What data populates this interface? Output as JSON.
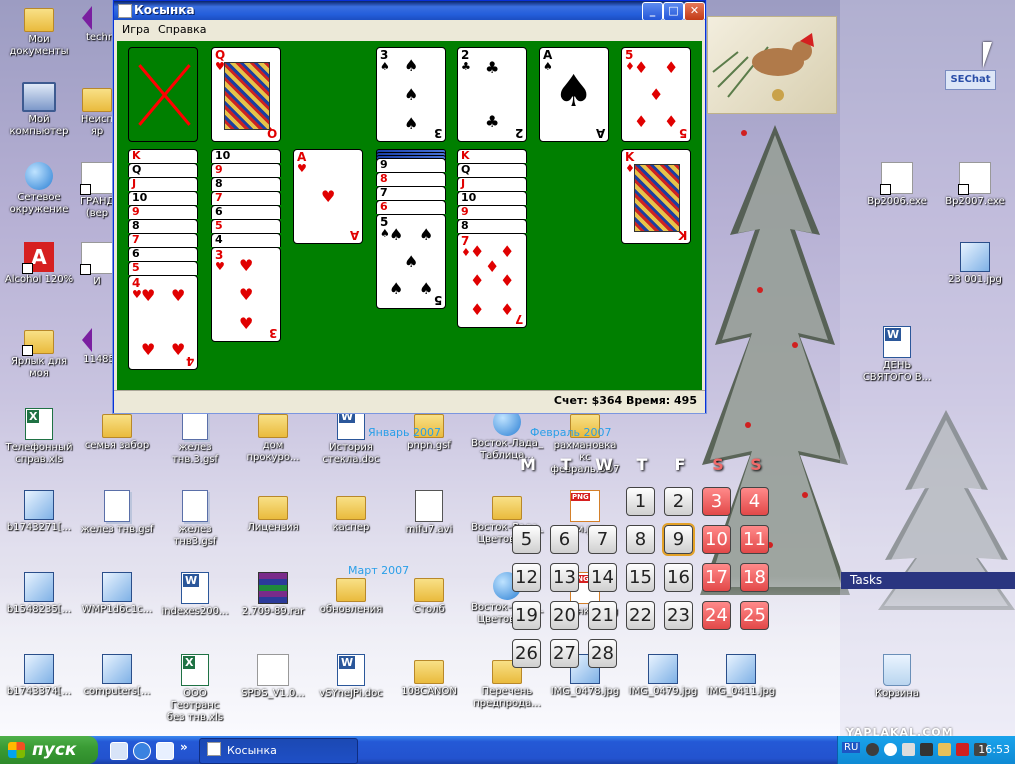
{
  "window": {
    "title": "Косынка",
    "menu": [
      "Игра",
      "Справка"
    ],
    "status": "Счет: $364 Время: 495"
  },
  "game": {
    "foundations": [
      {
        "rank": "3",
        "suit": "♠"
      },
      {
        "rank": "2",
        "suit": "♣"
      },
      {
        "rank": "A",
        "suit": "♠"
      },
      {
        "rank": "5",
        "suit": "♦"
      }
    ],
    "waste": {
      "rank": "Q",
      "suit": "♥"
    },
    "tableau": [
      {
        "stubs": [
          "K",
          "Q",
          "J",
          "10",
          "9",
          "8",
          "7",
          "6",
          "5"
        ],
        "top": {
          "rank": "4",
          "suit": "♥"
        }
      },
      {
        "stubs": [
          "10",
          "9",
          "8",
          "7",
          "6",
          "5",
          "4"
        ],
        "top": {
          "rank": "3",
          "suit": "♥"
        }
      },
      {
        "stubs": [],
        "top": {
          "rank": "A",
          "suit": "♥"
        }
      },
      {
        "stubs": [
          "9",
          "8",
          "7",
          "6"
        ],
        "top": {
          "rank": "5",
          "suit": "♠"
        }
      },
      {
        "stubs": [
          "K",
          "Q",
          "J",
          "10",
          "9",
          "8"
        ],
        "top": {
          "rank": "7",
          "suit": "♦"
        }
      },
      {
        "stubs": [],
        "top": {
          "rank": "K",
          "suit": "♦"
        }
      }
    ]
  },
  "desktop_icons": {
    "col1": [
      "Мои\nдокументы",
      "Мой\nкомпьютер",
      "Сетевое\nокружение",
      "Alcohol 120%",
      "Ярлык для\nмоя",
      "Телефонный\nсправ.xls",
      "b1743271[...",
      "b1548235[...",
      "b1743374[..."
    ],
    "col2": [
      "techr",
      "Неисп\nяр",
      "ГРАНД\n(вер",
      "И",
      "11485"
    ],
    "row_a": [
      "семья забор",
      "желез\nтнв.3.gsf",
      "дом\nпрокуро...",
      "История\nстекла.doc",
      "pnpn.gsf",
      "Восток-Лада_\nТаблица...",
      "рахмановка кс\nфевраль.ЗО7"
    ],
    "row_b": [
      "желез тнв.gsf",
      "желез\nтнв3.gsf",
      "Лицензия",
      "каспер",
      "mifu7.avi",
      "Восток-Лада_\nЦветовая...",
      "сом.png"
    ],
    "row_c": [
      "WMP1d6c1c...",
      "indexes200...",
      "2.709-89.rar",
      "обновления",
      "Столб",
      "Восток-Лада_\nЦветовая...",
      "кабинка.png"
    ],
    "row_d": [
      "computers[...",
      "ООО Геотранс\nбез тнв.xls",
      "SPDS_V1.0...",
      "vSYneJPi.doc",
      "108CANON",
      "Перечень\nпредпрода...",
      "IMG_0478.jpg",
      "IMG_0479.jpg",
      "IMG_0411.jpg"
    ],
    "right": [
      "Bp2006.exe",
      "Bp2007.exe",
      "23 001.jpg",
      "ДЕНЬ\nСВЯТОГО В...",
      "Корзина"
    ]
  },
  "calendar": {
    "headers": [
      "M",
      "T",
      "W",
      "T",
      "F",
      "S",
      "S"
    ],
    "weeks": [
      [
        "",
        "",
        "",
        "1",
        "2",
        "3",
        "4"
      ],
      [
        "5",
        "6",
        "7",
        "8",
        "9",
        "10",
        "11"
      ],
      [
        "12",
        "13",
        "14",
        "15",
        "16",
        "17",
        "18"
      ],
      [
        "19",
        "20",
        "21",
        "22",
        "23",
        "24",
        "25"
      ],
      [
        "26",
        "27",
        "28",
        "",
        "",
        "",
        ""
      ]
    ],
    "today": "9",
    "mini_month_1": "Январь 2007",
    "mini_month_2": "Март 2007",
    "mini_month_3": "Февраль 2007"
  },
  "widgets": {
    "sechat": "SEChat",
    "tasks": "Tasks",
    "watermark": "YAPLAKAL.COM"
  },
  "taskbar": {
    "start_label": "пуск",
    "task_label": "Косынка",
    "lang": "RU",
    "clock": "16:53"
  }
}
